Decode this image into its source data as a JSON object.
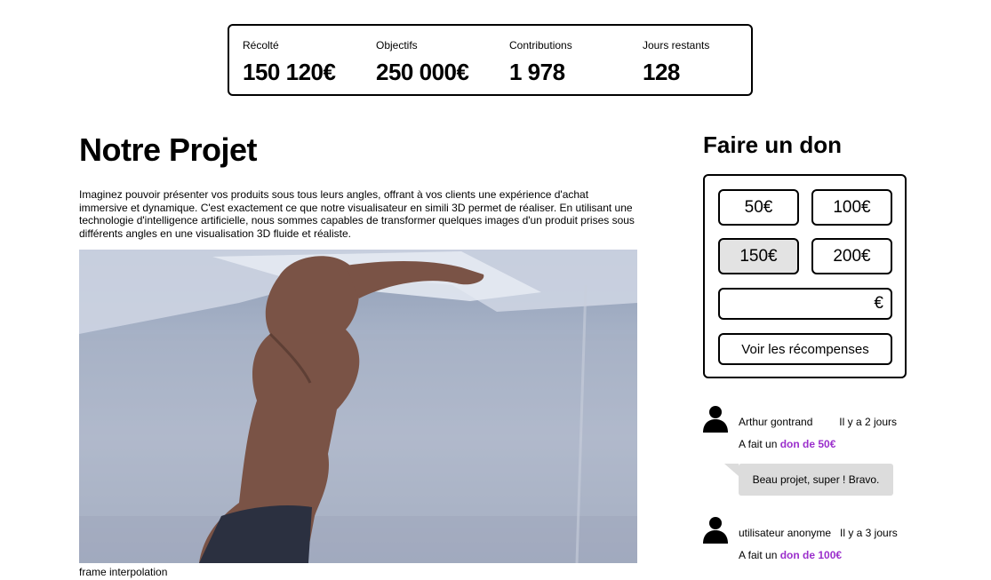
{
  "stats": [
    {
      "label": "Récolté",
      "value": "150 120€"
    },
    {
      "label": "Objectifs",
      "value": "250 000€"
    },
    {
      "label": "Contributions",
      "value": "1 978"
    },
    {
      "label": "Jours restants",
      "value": "128"
    }
  ],
  "project": {
    "title": "Notre Projet",
    "description": "Imaginez pouvoir présenter vos produits sous tous leurs angles, offrant à vos clients une expérience d'achat immersive et dynamique. C'est exactement ce que notre visualisateur en simili 3D permet de réaliser. En utilisant une technologie d'intelligence artificielle, nous sommes capables de transformer quelques images d'un produit prises sous différents angles en une visualisation 3D fluide et réaliste.",
    "media_caption": "frame interpolation"
  },
  "donation": {
    "title": "Faire un don",
    "amounts": [
      "50€",
      "100€",
      "150€",
      "200€"
    ],
    "selected_amount": "150€",
    "custom_amount_value": "",
    "currency_symbol": "€",
    "rewards_label": "Voir les récompenses"
  },
  "donors": [
    {
      "name": "Arthur gontrand",
      "time": "Il y a 2 jours",
      "action_prefix": "A fait un",
      "action_amount": "don de 50€",
      "comment": "Beau projet, super ! Bravo."
    },
    {
      "name": "utilisateur anonyme",
      "time": "Il y a 3 jours",
      "action_prefix": "A fait un",
      "action_amount": "don de 100€"
    }
  ],
  "colors": {
    "accent": "#9b2fcc",
    "selected_button": "#e3e3e3",
    "comment_bubble": "#dcdcdc"
  }
}
